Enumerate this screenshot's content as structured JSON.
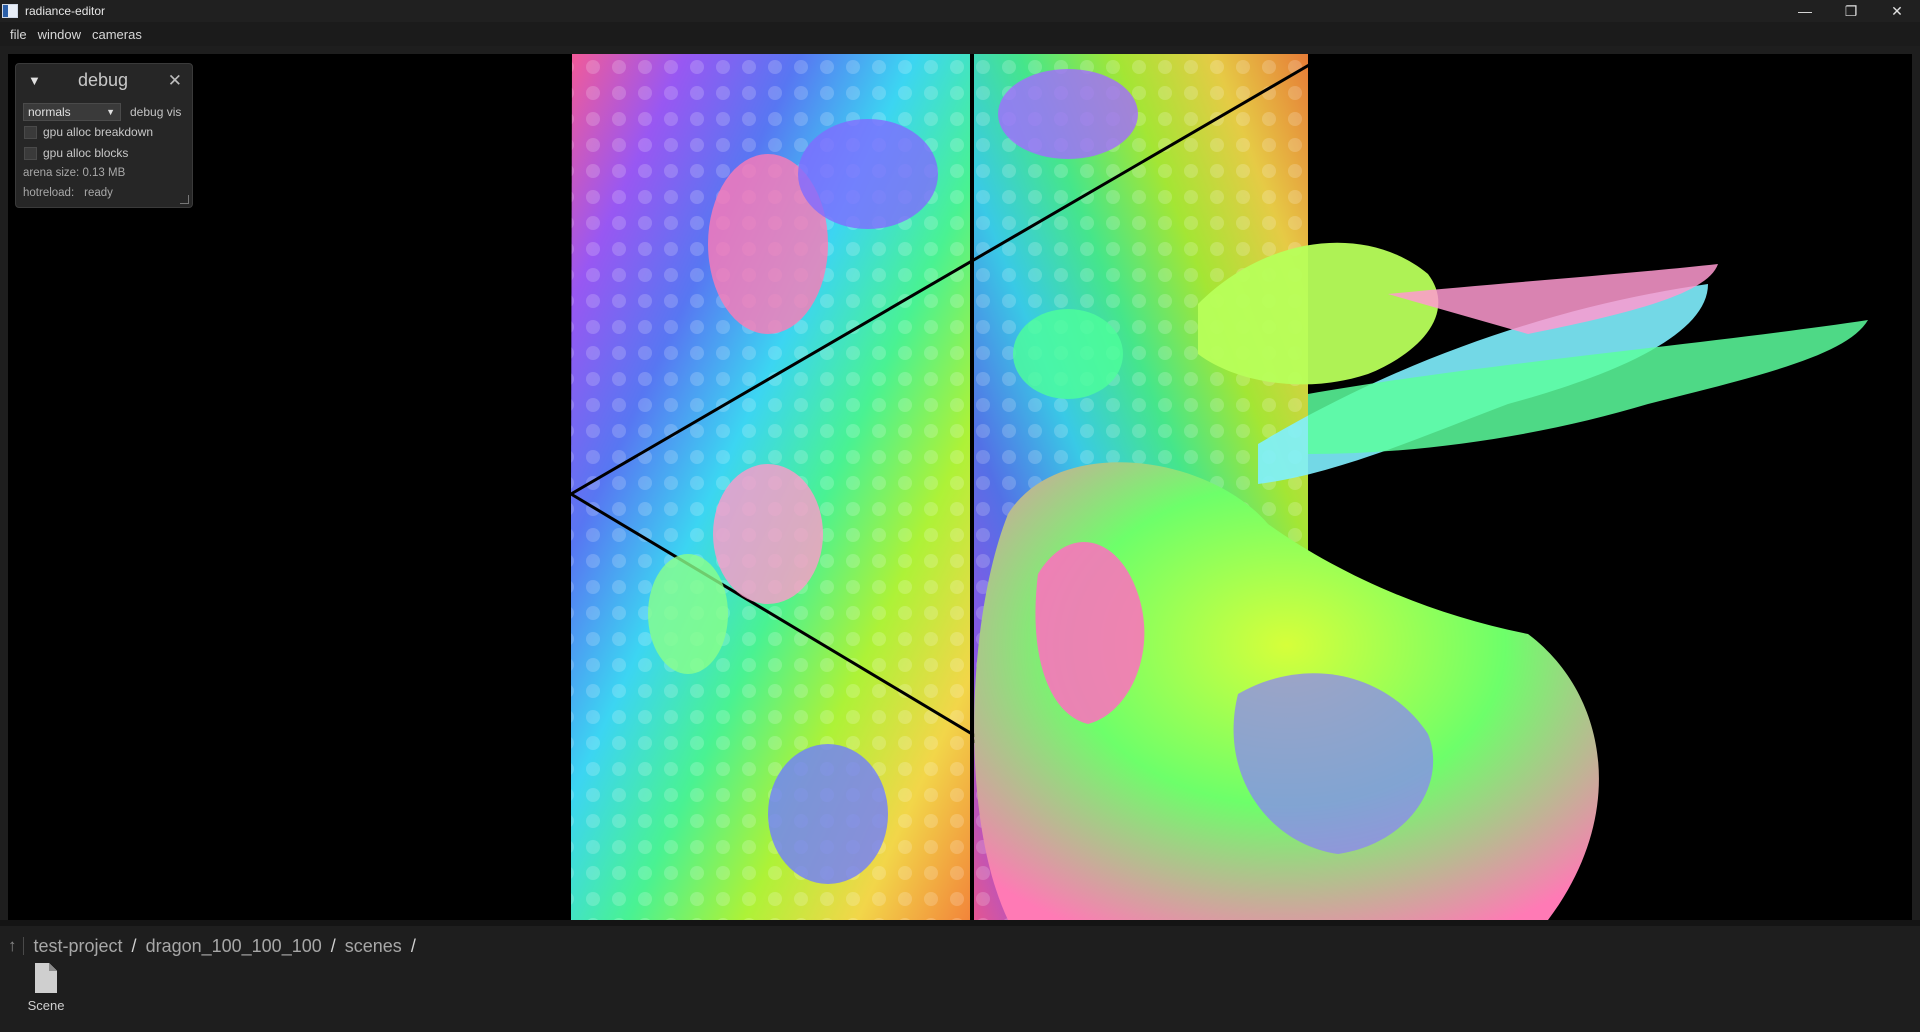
{
  "window": {
    "title": "radiance-editor",
    "controls": {
      "minimize": "—",
      "maximize": "❐",
      "close": "✕"
    }
  },
  "menu": [
    "file",
    "window",
    "cameras"
  ],
  "debug_panel": {
    "title": "debug",
    "collapse_icon": "▼",
    "close_icon": "✕",
    "vis_select": {
      "value": "normals",
      "label": "debug vis"
    },
    "checkboxes": [
      {
        "label": "gpu alloc breakdown",
        "checked": false
      },
      {
        "label": "gpu alloc blocks",
        "checked": false
      }
    ],
    "arena_size": "arena size: 0.13 MB",
    "hotreload_label": "hotreload:",
    "hotreload_status": "ready"
  },
  "viewport": {
    "render_mode": "normals",
    "palette": [
      "#ff5fa0",
      "#a05cff",
      "#5c7dff",
      "#3fe0ff",
      "#4dff9a",
      "#b6ff3a",
      "#ffe14d",
      "#ff8a3d"
    ]
  },
  "file_browser": {
    "up_icon": "↑",
    "path": [
      "test-project",
      "dragon_100_100_100",
      "scenes"
    ],
    "items": [
      {
        "label": "Scene",
        "icon": "file-icon"
      }
    ]
  }
}
